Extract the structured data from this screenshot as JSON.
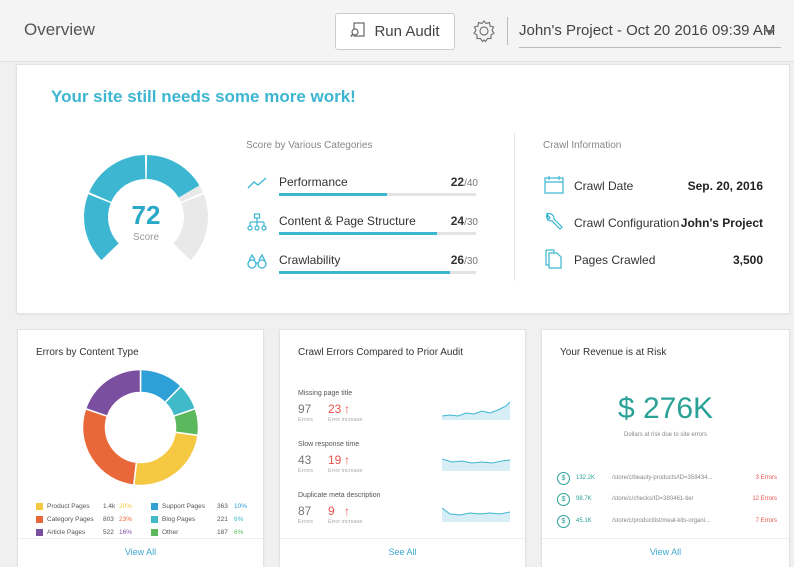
{
  "header": {
    "title": "Overview",
    "run_audit_label": "Run Audit",
    "project": "John's Project - Oct 20 2016 09:39 AM"
  },
  "overview": {
    "headline": "Your site still needs some more work!",
    "score": "72",
    "score_label": "Score",
    "score_fraction": 0.72,
    "categories_title": "Score by Various Categories",
    "categories": [
      {
        "label": "Performance",
        "score": "22",
        "max": "/40",
        "fraction": 0.55,
        "icon": "trend-line-icon"
      },
      {
        "label": "Content & Page Structure",
        "score": "24",
        "max": "/30",
        "fraction": 0.8,
        "icon": "sitemap-icon"
      },
      {
        "label": "Crawlability",
        "score": "26",
        "max": "/30",
        "fraction": 0.87,
        "icon": "binoculars-icon"
      }
    ],
    "crawl_title": "Crawl Information",
    "crawl": [
      {
        "label": "Crawl Date",
        "value": "Sep. 20, 2016",
        "icon": "calendar-icon"
      },
      {
        "label": "Crawl Configuration",
        "value": "John's Project",
        "icon": "wrench-icon"
      },
      {
        "label": "Pages Crawled",
        "value": "3,500",
        "icon": "pages-icon"
      }
    ]
  },
  "errors_by_content": {
    "title": "Errors by Content Type",
    "legend": [
      {
        "label": "Product Pages",
        "count": "1.4k",
        "pct": "20%",
        "color": "#f5c842"
      },
      {
        "label": "Category Pages",
        "count": "803",
        "pct": "23%",
        "color": "#e8683a"
      },
      {
        "label": "Article Pages",
        "count": "522",
        "pct": "16%",
        "color": "#7b4fa0"
      },
      {
        "label": "Support Pages",
        "count": "363",
        "pct": "10%",
        "color": "#2f9fd8"
      },
      {
        "label": "Blog Pages",
        "count": "221",
        "pct": "6%",
        "color": "#40b9c9"
      },
      {
        "label": "Other",
        "count": "187",
        "pct": "6%",
        "color": "#5cb85c"
      }
    ],
    "view_all": "View All"
  },
  "crawl_errors": {
    "title": "Crawl Errors Compared to Prior Audit",
    "items": [
      {
        "label": "Missing page title",
        "prior": "97",
        "current": "23",
        "prior_sub": "Errors",
        "current_sub": "Error increase"
      },
      {
        "label": "Slow response time",
        "prior": "43",
        "current": "19",
        "prior_sub": "Errors",
        "current_sub": "Error increase"
      },
      {
        "label": "Duplicate meta description",
        "prior": "87",
        "current": "9",
        "prior_sub": "Errors",
        "current_sub": "Error increase"
      }
    ],
    "see_all": "See All"
  },
  "revenue": {
    "title": "Your Revenue is at Risk",
    "amount": "$ 276K",
    "subtitle": "Dollars at risk due to site errors",
    "rows": [
      {
        "amount": "132.2K",
        "url": "/store/c/beauty-products/ID=359434...",
        "errors": "3 Errors"
      },
      {
        "amount": "98.7K",
        "url": "/store/c/checks/ID=380461-tier",
        "errors": "12 Errors"
      },
      {
        "amount": "45.1K",
        "url": "/store/c/productlist/meal-kits-organi...",
        "errors": "7 Errors"
      }
    ],
    "view_all": "View All"
  },
  "colors": {
    "accent": "#3db6d2",
    "danger": "#e8534a",
    "money": "#2aa197"
  }
}
